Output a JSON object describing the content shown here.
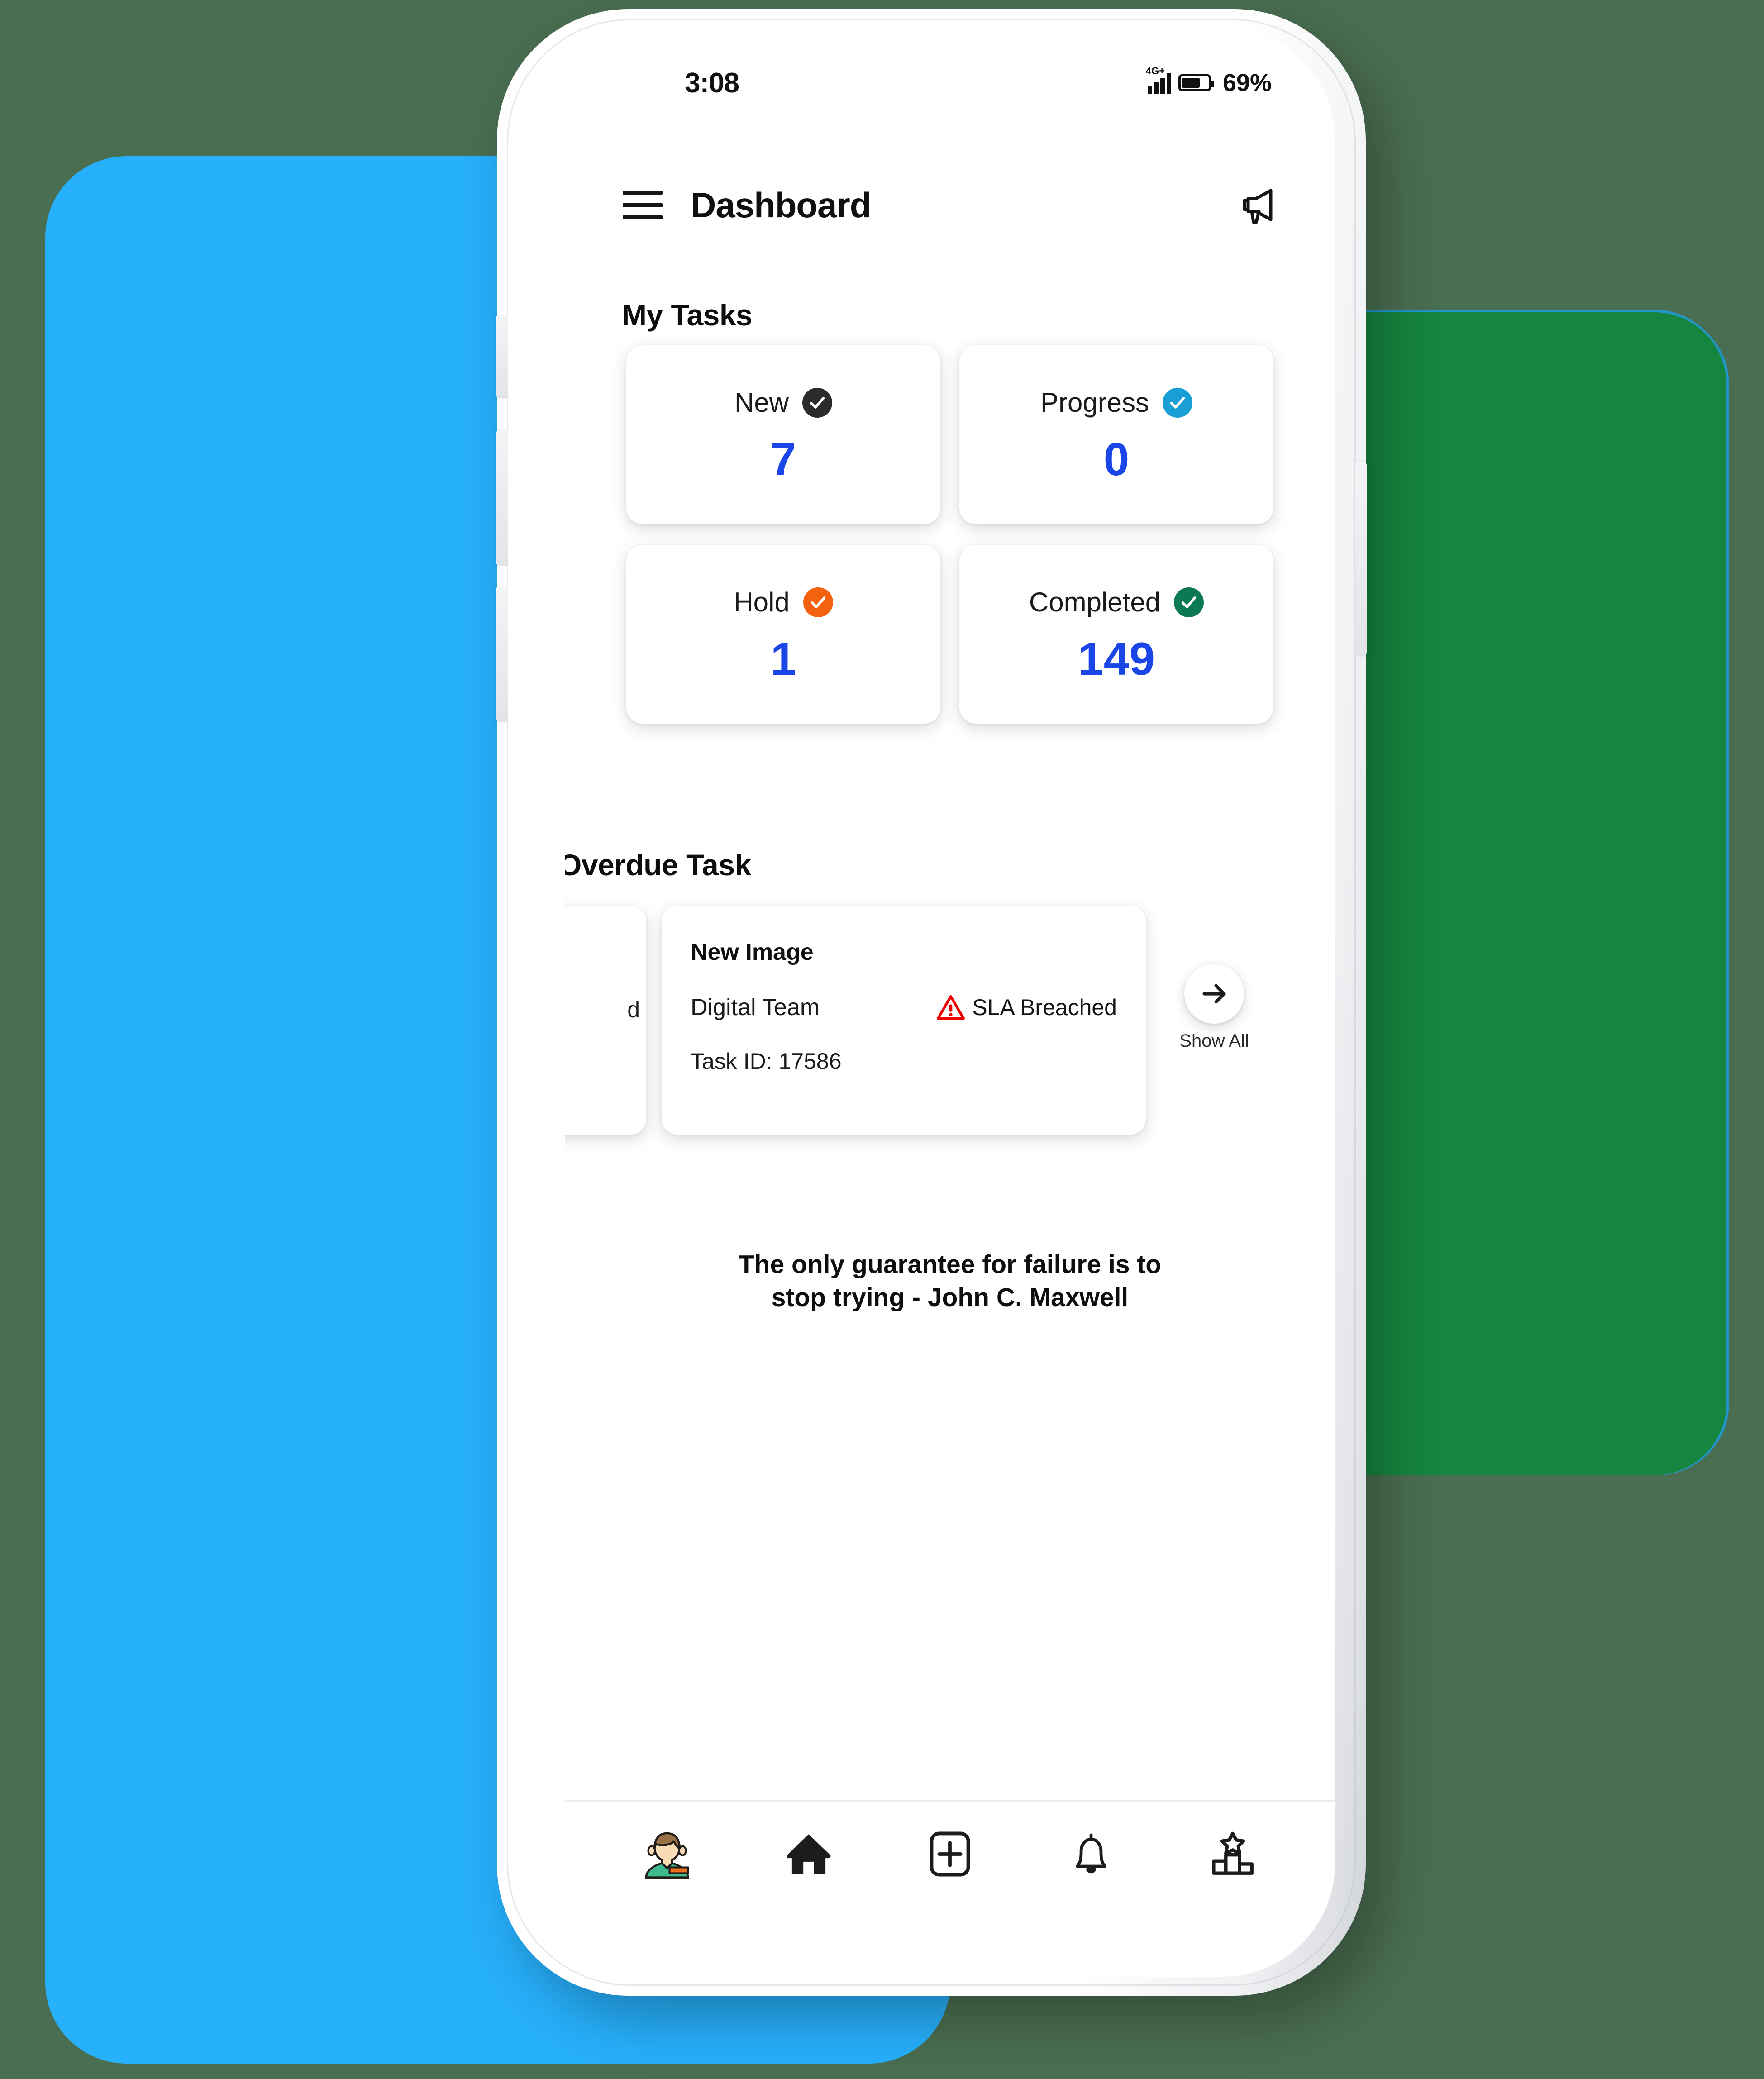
{
  "background": {
    "page_color": "#4a6e51",
    "blue_panel_color": "#27b0fc",
    "green_panel_color": "#15853f",
    "green_panel_outline": "#2196c8"
  },
  "status_bar": {
    "time": "3:08",
    "network": "4G+",
    "battery_percent": "69%",
    "battery_level": 69
  },
  "app_bar": {
    "menu_icon": "hamburger-menu-icon",
    "title": "Dashboard",
    "action_icon": "megaphone-icon"
  },
  "my_tasks": {
    "section_title": "My Tasks",
    "cards": [
      {
        "label": "New",
        "value": "7",
        "badge_icon": "check-circle-icon",
        "badge_color": "#2b2b2b"
      },
      {
        "label": "Progress",
        "value": "0",
        "badge_icon": "check-circle-icon",
        "badge_color": "#1a9fd4"
      },
      {
        "label": "Hold",
        "value": "1",
        "badge_icon": "check-circle-icon",
        "badge_color": "#f4620f"
      },
      {
        "label": "Completed",
        "value": "149",
        "badge_icon": "check-circle-icon",
        "badge_color": "#0b7a54"
      }
    ],
    "value_color": "#1a46e8"
  },
  "overdue": {
    "section_title": "Overdue Task",
    "previous_card_fragment": "d",
    "card": {
      "title": "New Image",
      "team": "Digital Team",
      "status_text": "SLA Breached",
      "status_icon": "warning-triangle-icon",
      "status_color": "#ee0000",
      "task_id": "Task ID: 17586"
    },
    "show_all": {
      "label": "Show All",
      "icon": "arrow-right-icon"
    }
  },
  "quote": {
    "line1": "The only guarantee for failure is to",
    "line2": "stop trying - John C. Maxwell"
  },
  "bottom_nav": {
    "items": [
      {
        "icon": "office-worker-avatar-icon",
        "name": "profile"
      },
      {
        "icon": "home-icon",
        "name": "home"
      },
      {
        "icon": "plus-box-icon",
        "name": "add"
      },
      {
        "icon": "bell-icon",
        "name": "notifications"
      },
      {
        "icon": "leaderboard-podium-icon",
        "name": "leaderboard"
      }
    ]
  }
}
